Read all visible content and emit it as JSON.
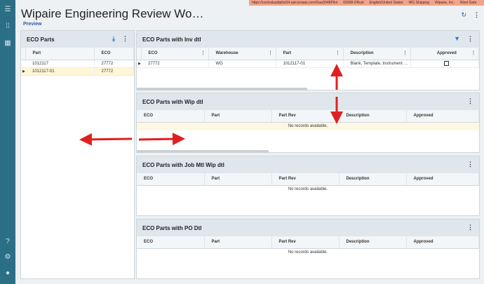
{
  "app": {
    "title": "Wipaire Engineering Review Wo…",
    "preview_label": "Preview"
  },
  "infostrip": [
    "https://centralusdtpilot34.epicorsaas.com/SaaS948Pilot",
    "65608-DRust",
    "English/United States",
    "WG Shipping",
    "Wipaire, Inc.",
    "West Gate"
  ],
  "icons": {
    "refresh": "refresh-icon",
    "more": "kebab-icon",
    "download": "download-icon",
    "filter": "filter-icon"
  },
  "eco_parts": {
    "title": "ECO Parts",
    "columns": [
      "Part",
      "ECO"
    ],
    "rows": [
      {
        "part": "1012117",
        "eco": "27772"
      },
      {
        "part": "1012117-01",
        "eco": "27772"
      }
    ]
  },
  "inv_dtl": {
    "title": "ECO Parts with Inv dtl",
    "columns": [
      "ECO",
      "Warehouse",
      "Part",
      "Description",
      "Approved"
    ],
    "rows": [
      {
        "eco": "27772",
        "warehouse": "WG",
        "part": "1012117-01",
        "description": "Blank, Template, Instrument …"
      }
    ]
  },
  "wip_dtl": {
    "title": "ECO Parts with Wip dtl",
    "columns": [
      "ECO",
      "Part",
      "Part Rev",
      "Description",
      "Approved"
    ],
    "empty": "No records available."
  },
  "job_mtl": {
    "title": "ECO Parts with Job Mtl Wip dtl",
    "columns": [
      "ECO",
      "Part",
      "Part Rev",
      "Description",
      "Approved"
    ],
    "empty": "No records available."
  },
  "po_dtl": {
    "title": "ECO Parts with PO Dtl",
    "columns": [
      "ECO",
      "Part",
      "Part Rev",
      "Description",
      "Approved"
    ],
    "empty": "No records available."
  },
  "colors": {
    "nav": "#2b6f86",
    "infostrip": "#f2a38b",
    "annotation_arrow": "#e02020"
  }
}
